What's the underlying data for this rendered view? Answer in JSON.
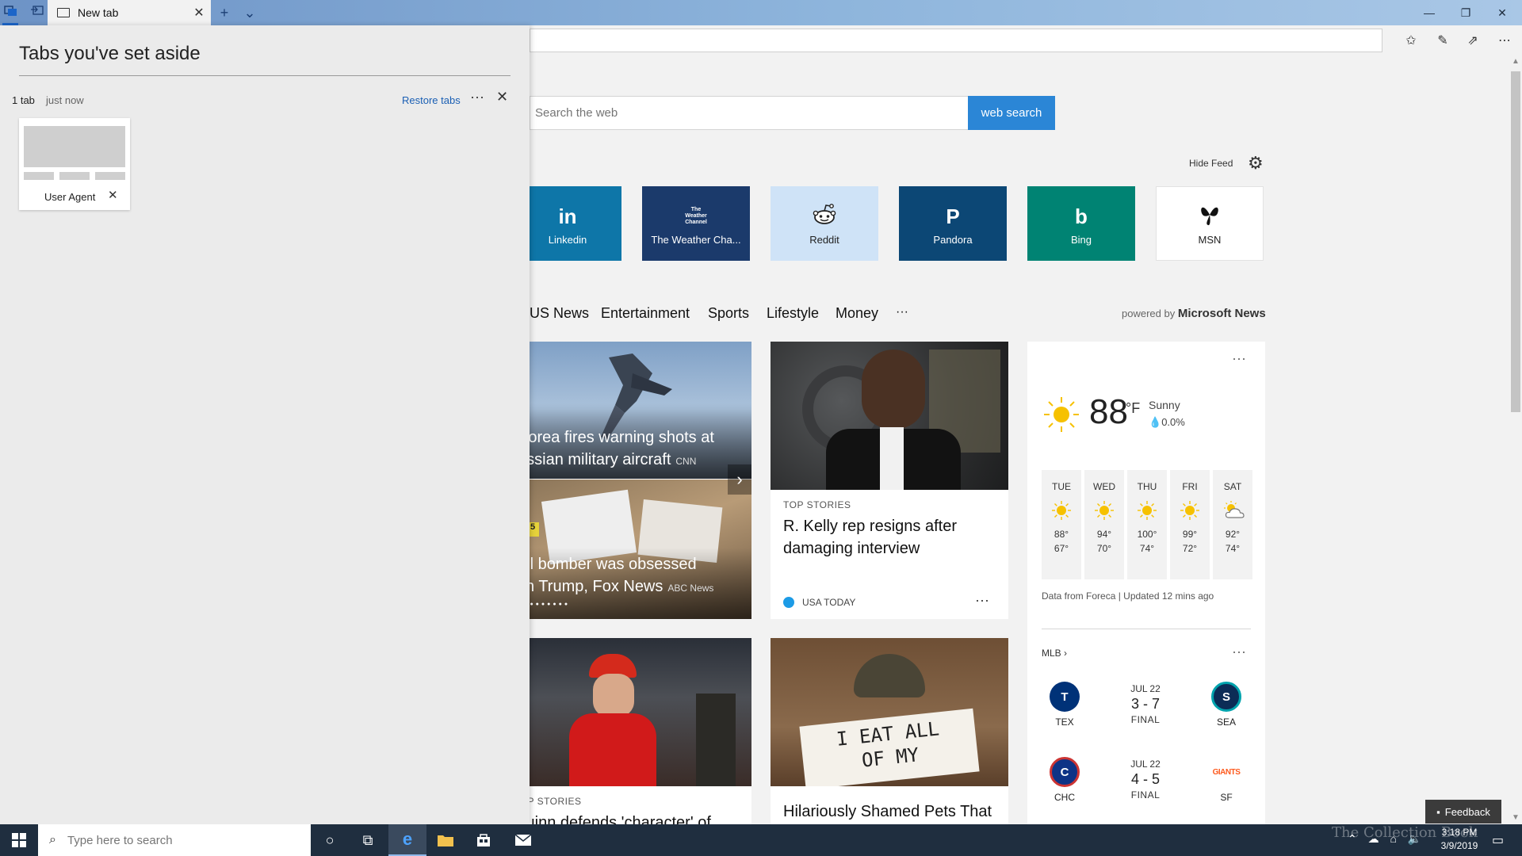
{
  "browser": {
    "tab_title": "New tab",
    "window_controls": [
      "—",
      "❐",
      "✕"
    ]
  },
  "search": {
    "placeholder": "Search the web",
    "button_label": "web search"
  },
  "feed": {
    "hide_label": "Hide Feed"
  },
  "tiles": [
    {
      "label": "Linkedin",
      "glyph": "in",
      "bg": "#0e76a8",
      "fg": "#ffffff"
    },
    {
      "label": "The Weather Cha...",
      "glyph": "The Weather Channel",
      "bg": "#1b3a6b",
      "fg": "#ffffff"
    },
    {
      "label": "Reddit",
      "glyph": "reddit-alien",
      "bg": "#cfe3f7",
      "fg": "#222222"
    },
    {
      "label": "Pandora",
      "glyph": "P",
      "bg": "#0c4775",
      "fg": "#ffffff"
    },
    {
      "label": "Bing",
      "glyph": "b",
      "bg": "#008373",
      "fg": "#ffffff"
    },
    {
      "label": "MSN",
      "glyph": "msn-butterfly",
      "bg": "#ffffff",
      "fg": "#222222"
    }
  ],
  "news_nav": {
    "items": [
      "US News",
      "Entertainment",
      "Sports",
      "Lifestyle",
      "Money",
      "···"
    ],
    "powered_prefix": "powered by",
    "powered_brand": "Microsoft News"
  },
  "stories": {
    "hero1": {
      "title_line1": "Korea fires warning shots at",
      "title_line2": "ussian military aircraft",
      "source": "CNN"
    },
    "hero2": {
      "title_line1": "ail bomber was obsessed",
      "title_line2": "ith Trump, Fox News",
      "source": "ABC News",
      "evidence_tag": "5"
    },
    "top": {
      "eyebrow": "TOP STORIES",
      "title": "R. Kelly rep resigns after damaging interview",
      "source": "USA TODAY",
      "more": "···"
    },
    "bottom_left": {
      "eyebrow": "TOP STORIES",
      "title": "Quinn defends 'character' of"
    },
    "bottom_right": {
      "title": "Hilariously Shamed Pets That",
      "sign_line1": "I EAT ALL",
      "sign_line2": "OF MY"
    }
  },
  "weather": {
    "temp": "88",
    "unit": "°F",
    "condition": "Sunny",
    "precip": "0.0%",
    "more": "···",
    "forecast": [
      {
        "day": "TUE",
        "hi": "88°",
        "lo": "67°",
        "icon": "sun-icon"
      },
      {
        "day": "WED",
        "hi": "94°",
        "lo": "70°",
        "icon": "sun-icon"
      },
      {
        "day": "THU",
        "hi": "100°",
        "lo": "74°",
        "icon": "sun-icon"
      },
      {
        "day": "FRI",
        "hi": "99°",
        "lo": "72°",
        "icon": "sun-icon"
      },
      {
        "day": "SAT",
        "hi": "92°",
        "lo": "74°",
        "icon": "partly-cloudy-icon"
      }
    ],
    "attribution": "Data from Foreca | Updated 12 mins ago"
  },
  "mlb": {
    "header": "MLB",
    "more": "···",
    "games": [
      {
        "home": "TEX",
        "away": "SEA",
        "date": "JUL 22",
        "score": "3 - 7",
        "status": "FINAL",
        "home_logo": "T",
        "away_logo": "S",
        "home_color": "#003278",
        "away_color": "#0c2c56"
      },
      {
        "home": "CHC",
        "away": "SF",
        "date": "JUL 22",
        "score": "4 - 5",
        "status": "FINAL",
        "home_logo": "C",
        "away_logo": "GIANTS",
        "home_color": "#0e3386",
        "away_color": "#fd5a1e"
      }
    ]
  },
  "aside": {
    "title": "Tabs you've set aside",
    "count": "1 tab",
    "time": "just now",
    "restore_label": "Restore tabs",
    "more": "···",
    "thumb_label": "User Agent"
  },
  "feedback_label": "Feedback",
  "taskbar": {
    "search_placeholder": "Type here to search",
    "time": "3:18 PM",
    "date": "3/9/2019"
  },
  "watermark": "The Collection Book"
}
